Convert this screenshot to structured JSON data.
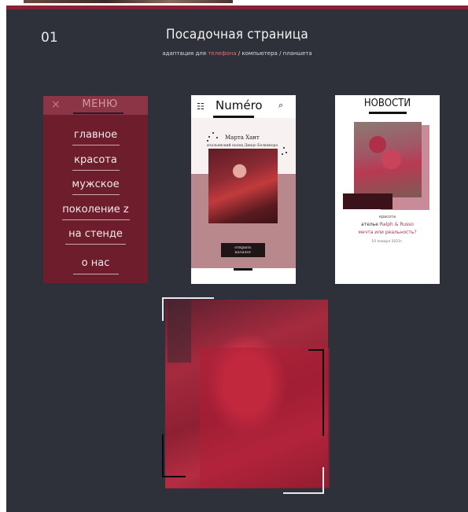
{
  "header": {
    "number": "01",
    "title": "Посадочная страница",
    "subtitle_prefix": "адаптация для ",
    "subtitle_accent": "телефона",
    "subtitle_suffix": " / компьютера / планшета"
  },
  "menu": {
    "close_symbol": "×",
    "title": "МЕНЮ",
    "items": [
      "главное",
      "красота",
      "мужское",
      "поколение z",
      "на стенде",
      "о нас"
    ]
  },
  "numero": {
    "burger_symbol": "☷",
    "logo": "Numéro",
    "search_symbol": "⌕",
    "author": "Марта Хант",
    "caption": "итальянский палец Диндо Белкинора",
    "button_line1": "открыть",
    "button_line2": "каталог"
  },
  "news": {
    "title": "НОВОСТИ",
    "category": "красота",
    "headline_dark": "ателье ",
    "headline_accent": "Ralph & Russo",
    "subhead": "мечта или реальность?",
    "date": "10 января 2021г."
  },
  "colors": {
    "background": "#2f313a",
    "accent": "#8a1f35",
    "menu_bg": "#6e1d2c"
  }
}
